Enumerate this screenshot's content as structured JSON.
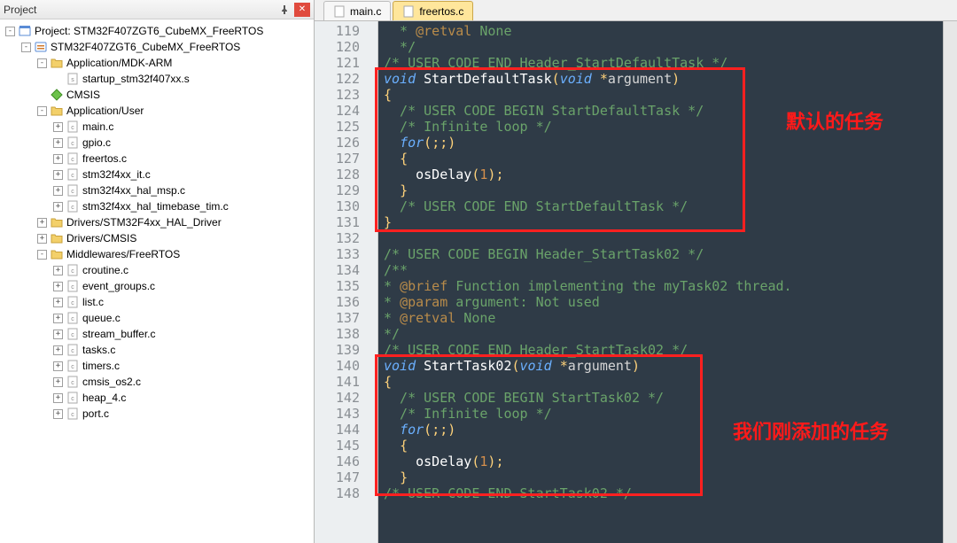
{
  "panel": {
    "title": "Project"
  },
  "tree": [
    {
      "depth": 0,
      "exp": "-",
      "icon": "workspace",
      "label": "Project: STM32F407ZGT6_CubeMX_FreeRTOS"
    },
    {
      "depth": 1,
      "exp": "-",
      "icon": "target",
      "label": "STM32F407ZGT6_CubeMX_FreeRTOS"
    },
    {
      "depth": 2,
      "exp": "-",
      "icon": "folder",
      "label": "Application/MDK-ARM"
    },
    {
      "depth": 3,
      "exp": " ",
      "icon": "asm",
      "label": "startup_stm32f407xx.s"
    },
    {
      "depth": 2,
      "exp": " ",
      "icon": "diamond",
      "label": "CMSIS"
    },
    {
      "depth": 2,
      "exp": "-",
      "icon": "folder",
      "label": "Application/User"
    },
    {
      "depth": 3,
      "exp": "+",
      "icon": "cfile",
      "label": "main.c"
    },
    {
      "depth": 3,
      "exp": "+",
      "icon": "cfile",
      "label": "gpio.c"
    },
    {
      "depth": 3,
      "exp": "+",
      "icon": "cfile",
      "label": "freertos.c"
    },
    {
      "depth": 3,
      "exp": "+",
      "icon": "cfile",
      "label": "stm32f4xx_it.c"
    },
    {
      "depth": 3,
      "exp": "+",
      "icon": "cfile",
      "label": "stm32f4xx_hal_msp.c"
    },
    {
      "depth": 3,
      "exp": "+",
      "icon": "cfile",
      "label": "stm32f4xx_hal_timebase_tim.c"
    },
    {
      "depth": 2,
      "exp": "+",
      "icon": "folder",
      "label": "Drivers/STM32F4xx_HAL_Driver"
    },
    {
      "depth": 2,
      "exp": "+",
      "icon": "folder",
      "label": "Drivers/CMSIS"
    },
    {
      "depth": 2,
      "exp": "-",
      "icon": "folder",
      "label": "Middlewares/FreeRTOS"
    },
    {
      "depth": 3,
      "exp": "+",
      "icon": "cfile",
      "label": "croutine.c"
    },
    {
      "depth": 3,
      "exp": "+",
      "icon": "cfile",
      "label": "event_groups.c"
    },
    {
      "depth": 3,
      "exp": "+",
      "icon": "cfile",
      "label": "list.c"
    },
    {
      "depth": 3,
      "exp": "+",
      "icon": "cfile",
      "label": "queue.c"
    },
    {
      "depth": 3,
      "exp": "+",
      "icon": "cfile",
      "label": "stream_buffer.c"
    },
    {
      "depth": 3,
      "exp": "+",
      "icon": "cfile",
      "label": "tasks.c"
    },
    {
      "depth": 3,
      "exp": "+",
      "icon": "cfile",
      "label": "timers.c"
    },
    {
      "depth": 3,
      "exp": "+",
      "icon": "cfile",
      "label": "cmsis_os2.c"
    },
    {
      "depth": 3,
      "exp": "+",
      "icon": "cfile",
      "label": "heap_4.c"
    },
    {
      "depth": 3,
      "exp": "+",
      "icon": "cfile",
      "label": "port.c"
    }
  ],
  "tabs": [
    {
      "label": "main.c",
      "active": false
    },
    {
      "label": "freertos.c",
      "active": true
    }
  ],
  "code": {
    "first_line": 119,
    "lines": [
      "  * @retval None",
      "  */",
      "/* USER CODE END Header_StartDefaultTask */",
      "void StartDefaultTask(void *argument)",
      "{",
      "  /* USER CODE BEGIN StartDefaultTask */",
      "  /* Infinite loop */",
      "  for(;;)",
      "  {",
      "    osDelay(1);",
      "  }",
      "  /* USER CODE END StartDefaultTask */",
      "}",
      "",
      "/* USER CODE BEGIN Header_StartTask02 */",
      "/**",
      "* @brief Function implementing the myTask02 thread.",
      "* @param argument: Not used",
      "* @retval None",
      "*/",
      "/* USER CODE END Header_StartTask02 */",
      "void StartTask02(void *argument)",
      "{",
      "  /* USER CODE BEGIN StartTask02 */",
      "  /* Infinite loop */",
      "  for(;;)",
      "  {",
      "    osDelay(1);",
      "  }",
      "/* USER CODE END StartTask02 */"
    ]
  },
  "annotations": {
    "box1": "默认的任务",
    "box2": "我们刚添加的任务"
  }
}
